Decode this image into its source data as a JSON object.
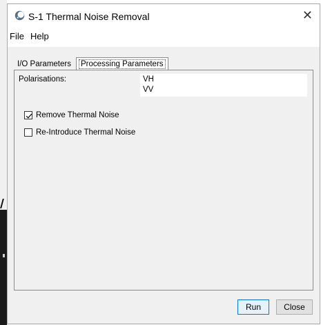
{
  "window": {
    "title": "S-1 Thermal Noise Removal",
    "close_glyph": "✕"
  },
  "menu": {
    "items": [
      "File",
      "Help"
    ]
  },
  "tabs": [
    {
      "label": "I/O Parameters",
      "active": false
    },
    {
      "label": "Processing Parameters",
      "active": true
    }
  ],
  "processing": {
    "polarisations_label": "Polarisations:",
    "polarisations": [
      "VH",
      "VV"
    ],
    "checkboxes": [
      {
        "label": "Remove Thermal Noise",
        "checked": true
      },
      {
        "label": "Re-Introduce Thermal Noise",
        "checked": false
      }
    ]
  },
  "buttons": {
    "run": "Run",
    "close": "Close"
  },
  "icons": {
    "app": "snap-app-icon",
    "window_close": "close-icon",
    "check": "checkmark-icon"
  },
  "colors": {
    "default_button_border": "#0078d7",
    "panel_bg": "#f0f0f0"
  }
}
